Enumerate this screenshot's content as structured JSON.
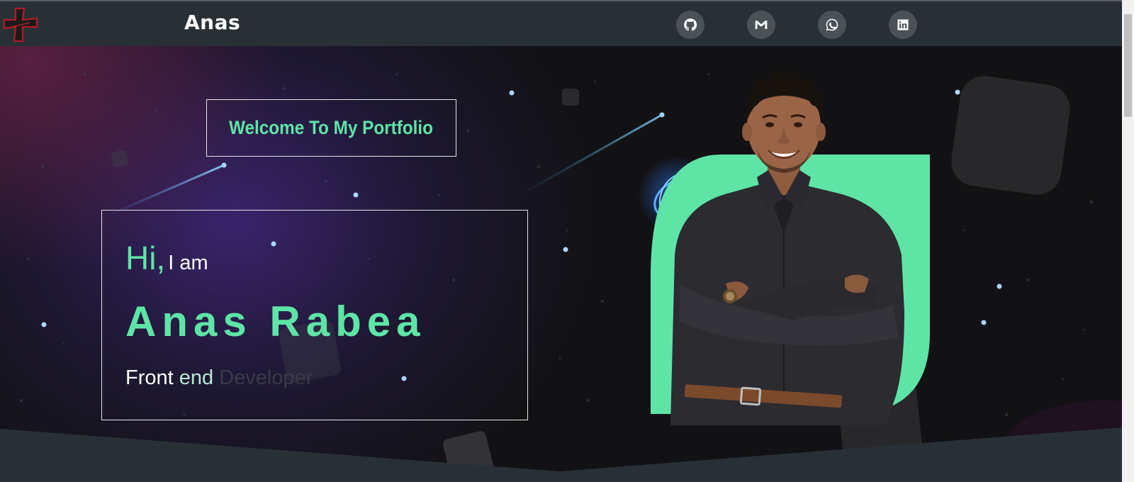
{
  "nav": {
    "brand": "Anas",
    "social": [
      {
        "name": "github-icon"
      },
      {
        "name": "gmail-icon"
      },
      {
        "name": "whatsapp-icon"
      },
      {
        "name": "linkedin-icon"
      }
    ]
  },
  "hero": {
    "welcome": "Welcome To My Portfolio",
    "hi": "Hi,",
    "iam": "I am",
    "name": "Anas Rabea",
    "role": {
      "w1": "Front",
      "w2": "end",
      "w3": "Developer"
    }
  },
  "colors": {
    "accent": "#5ee5a6",
    "nav_bg": "#283036",
    "hero_bg": "#121214"
  }
}
